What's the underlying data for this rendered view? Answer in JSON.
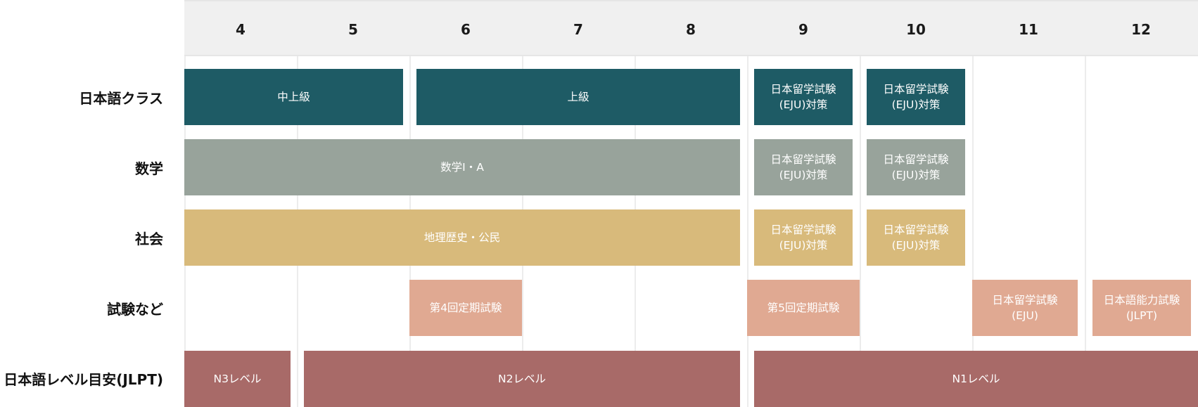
{
  "months": [
    "4",
    "5",
    "6",
    "7",
    "8",
    "9",
    "10",
    "11",
    "12"
  ],
  "rows": [
    {
      "label": "日本語クラス"
    },
    {
      "label": "数学"
    },
    {
      "label": "社会"
    },
    {
      "label": "試験など"
    },
    {
      "label": "日本語レベル目安(JLPT)"
    }
  ],
  "colors": {
    "japanese": "#1e5b65",
    "math": "#98a39b",
    "social": "#d8ba7b",
    "exam": "#e0a992",
    "level": "#a86a68"
  },
  "bars": {
    "japanese": [
      "中上級",
      "上級",
      "日本留学試験\n(EJU)対策",
      "日本留学試験\n(EJU)対策"
    ],
    "math": [
      "数学Ⅰ・A",
      "日本留学試験\n(EJU)対策",
      "日本留学試験\n(EJU)対策"
    ],
    "social": [
      "地理歴史・公民",
      "日本留学試験\n(EJU)対策",
      "日本留学試験\n(EJU)対策"
    ],
    "exam": [
      "第4回定期試験",
      "第5回定期試験",
      "日本留学試験\n(EJU)",
      "日本語能力試験\n(JLPT)"
    ],
    "level": [
      "N3レベル",
      "N2レベル",
      "N1レベル"
    ]
  }
}
